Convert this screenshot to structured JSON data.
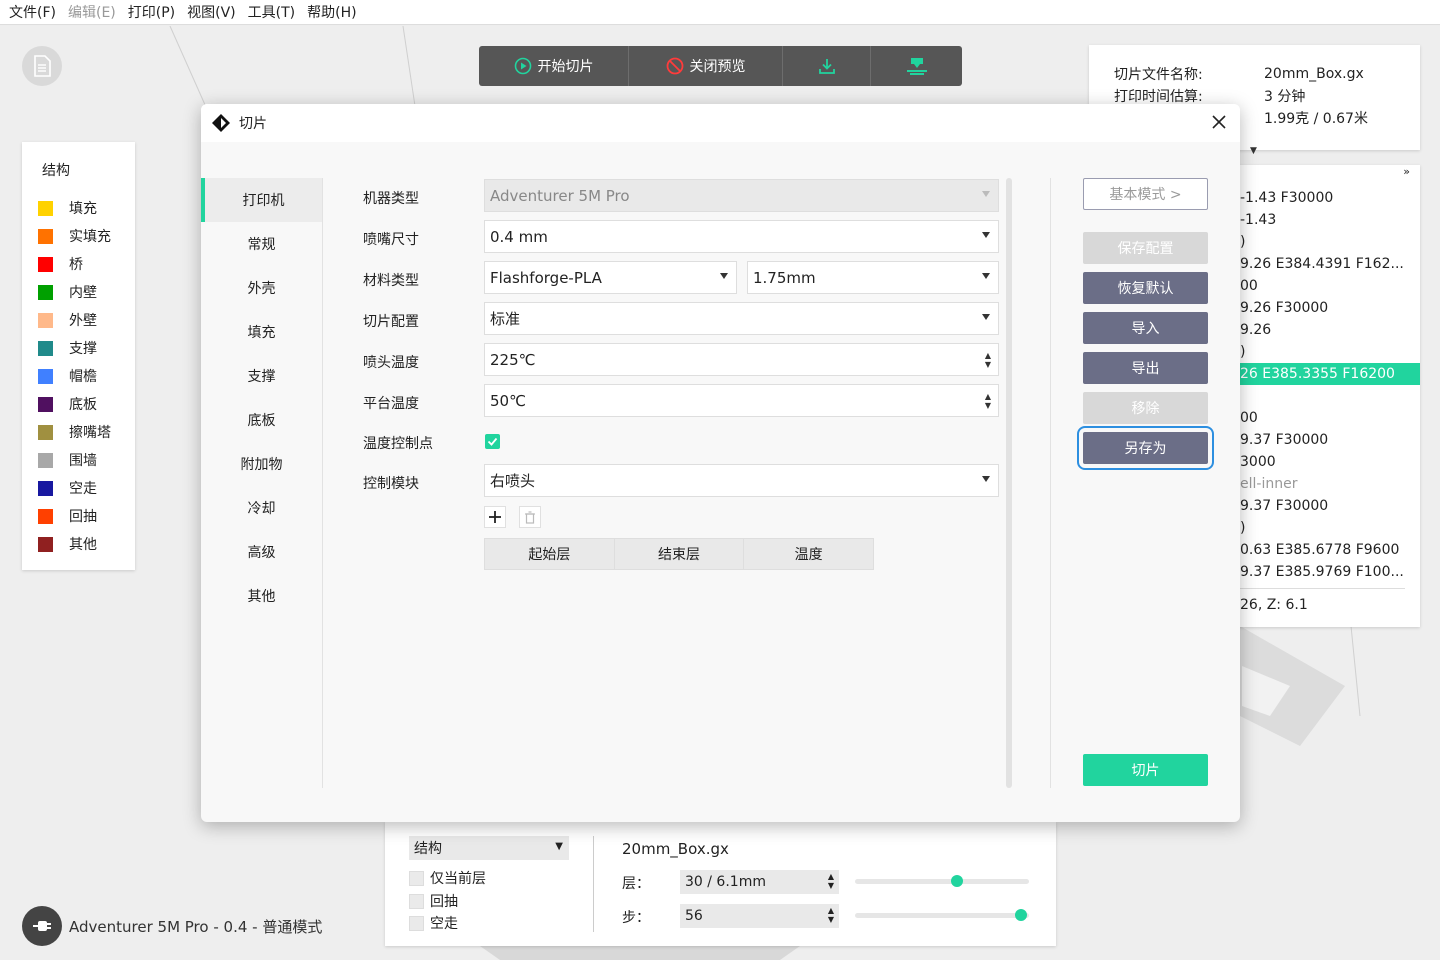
{
  "menu": [
    {
      "label": "文件(F)",
      "disabled": false
    },
    {
      "label": "编辑(E)",
      "disabled": true
    },
    {
      "label": "打印(P)",
      "disabled": false
    },
    {
      "label": "视图(V)",
      "disabled": false
    },
    {
      "label": "工具(T)",
      "disabled": false
    },
    {
      "label": "帮助(H)",
      "disabled": false
    }
  ],
  "toolbar": {
    "start_slice": "开始切片",
    "close_preview": "关闭预览"
  },
  "legend": {
    "title": "结构",
    "items": [
      {
        "label": "填充",
        "color": "#ffd200"
      },
      {
        "label": "实填充",
        "color": "#ff7200"
      },
      {
        "label": "桥",
        "color": "#ff0000"
      },
      {
        "label": "内壁",
        "color": "#00a000"
      },
      {
        "label": "外壁",
        "color": "#ffb98a"
      },
      {
        "label": "支撑",
        "color": "#208a8a"
      },
      {
        "label": "帽檐",
        "color": "#4080ff"
      },
      {
        "label": "底板",
        "color": "#501060"
      },
      {
        "label": "擦嘴塔",
        "color": "#a09040"
      },
      {
        "label": "围墙",
        "color": "#a8a8a8"
      },
      {
        "label": "空走",
        "color": "#1818a0"
      },
      {
        "label": "回抽",
        "color": "#ff4000"
      },
      {
        "label": "其他",
        "color": "#902020"
      }
    ]
  },
  "info": {
    "rows": [
      {
        "k": "切片文件名称:",
        "v": "20mm_Box.gx"
      },
      {
        "k": "打印时间估算:",
        "v": "3 分钟"
      },
      {
        "k": "",
        "v": "1.99克 / 0.67米"
      }
    ]
  },
  "gcode": {
    "lines": [
      {
        "text": "-1.43 F30000",
        "style": ""
      },
      {
        "text": "-1.43",
        "style": ""
      },
      {
        "text": ")",
        "style": ""
      },
      {
        "text": "9.26 E384.4391 F162...",
        "style": ""
      },
      {
        "text": "00",
        "style": ""
      },
      {
        "text": "9.26 F30000",
        "style": ""
      },
      {
        "text": "9.26",
        "style": ""
      },
      {
        "text": ")",
        "style": ""
      },
      {
        "text": "26 E385.3355 F16200",
        "style": "hl"
      },
      {
        "text": "",
        "style": ""
      },
      {
        "text": "00",
        "style": ""
      },
      {
        "text": "9.37 F30000",
        "style": ""
      },
      {
        "text": "3000",
        "style": ""
      },
      {
        "text": "ell-inner",
        "style": "dim"
      },
      {
        "text": "9.37 F30000",
        "style": ""
      },
      {
        "text": ")",
        "style": ""
      },
      {
        "text": "0.63 E385.6778 F9600",
        "style": ""
      },
      {
        "text": "9.37 E385.9769 F100...",
        "style": ""
      }
    ],
    "footer": "26, Z: 6.1"
  },
  "bottom": {
    "mode_select": "结构",
    "checks": [
      "仅当前层",
      "回抽",
      "空走"
    ],
    "filename": "20mm_Box.gx",
    "layer_label": "层：",
    "layer_value": "30 / 6.1mm",
    "step_label": "步：",
    "step_value": "56"
  },
  "status": "Adventurer 5M Pro - 0.4 - 普通模式",
  "dialog": {
    "title": "切片",
    "nav": [
      "打印机",
      "常规",
      "外壳",
      "填充",
      "支撑",
      "底板",
      "附加物",
      "冷却",
      "高级",
      "其他"
    ],
    "fields": {
      "machine_type_label": "机器类型",
      "machine_type": "Adventurer 5M Pro",
      "nozzle_label": "喷嘴尺寸",
      "nozzle": "0.4 mm",
      "material_label": "材料类型",
      "material": "Flashforge-PLA",
      "diameter": "1.75mm",
      "profile_label": "切片配置",
      "profile": "标准",
      "nozzle_temp_label": "喷头温度",
      "nozzle_temp": "225℃",
      "bed_temp_label": "平台温度",
      "bed_temp": "50℃",
      "temp_ctrl_label": "温度控制点",
      "control_module_label": "控制模块",
      "control_module": "右喷头"
    },
    "table_headers": [
      "起始层",
      "结束层",
      "温度"
    ],
    "buttons": {
      "basic_mode": "基本模式 >",
      "save_config": "保存配置",
      "restore_default": "恢复默认",
      "import": "导入",
      "export": "导出",
      "remove": "移除",
      "save_as": "另存为",
      "slice": "切片"
    }
  }
}
